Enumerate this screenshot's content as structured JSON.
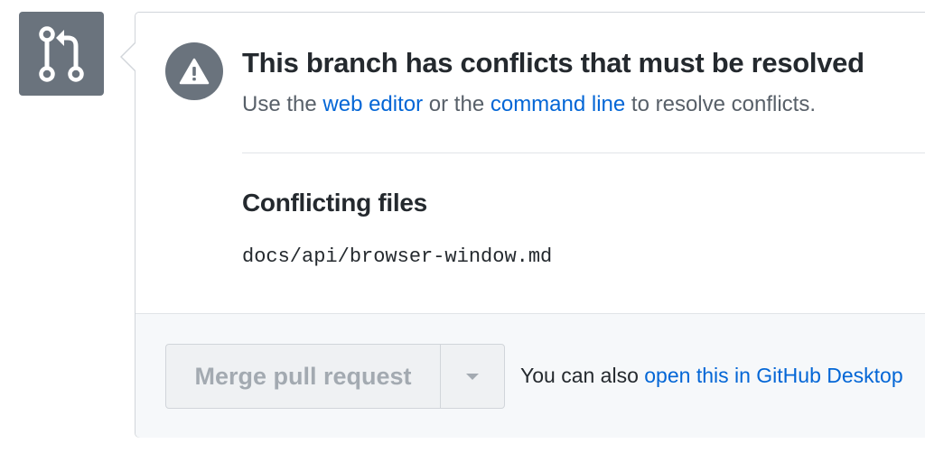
{
  "icons": {
    "pull_request": "git-pull-request-icon",
    "alert": "alert-triangle-icon",
    "dropdown": "triangle-down-icon"
  },
  "colors": {
    "badge_gray": "#6a737d",
    "link_blue": "#0366d6",
    "disabled_text": "#a3aab1",
    "footer_bg": "#f6f8fa"
  },
  "status": {
    "title": "This branch has conflicts that must be resolved",
    "desc_prefix": "Use the",
    "web_editor_link": "web editor",
    "desc_middle": "or the",
    "command_line_link": "command line",
    "desc_suffix": "to resolve conflicts."
  },
  "conflicts": {
    "heading": "Conflicting files",
    "files": [
      "docs/api/browser-window.md"
    ]
  },
  "merge": {
    "button_label": "Merge pull request",
    "button_disabled": true,
    "alt_prefix": "You can also",
    "alt_link": "open this in GitHub Desktop"
  }
}
